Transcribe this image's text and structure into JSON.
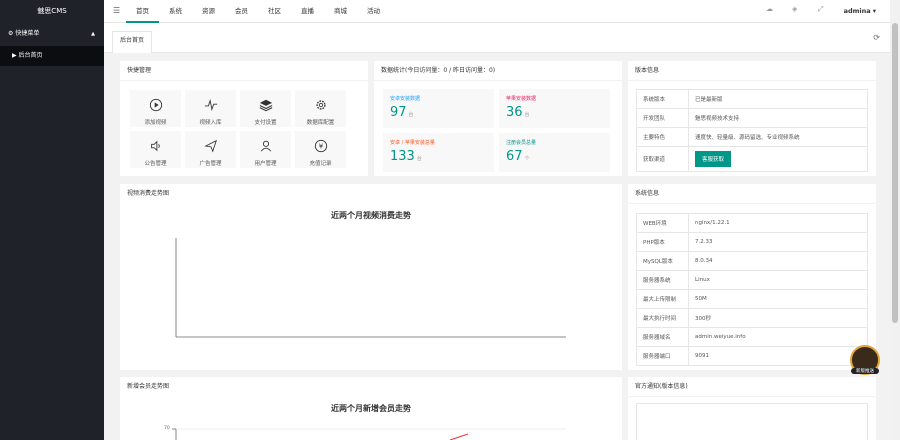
{
  "sidebar": {
    "logo": "魅思CMS",
    "menu_head": "快捷菜单",
    "menu_sub": "后台首页"
  },
  "topnav": {
    "items": [
      "首页",
      "系统",
      "资源",
      "会员",
      "社区",
      "直播",
      "商城",
      "活动"
    ],
    "user": "admina"
  },
  "tab": {
    "label": "后台首页"
  },
  "quick": {
    "title": "快捷管理",
    "items": [
      {
        "label": "添加视频",
        "icon": "play-icon"
      },
      {
        "label": "视频入库",
        "icon": "pulse-icon"
      },
      {
        "label": "支付设置",
        "icon": "layers-icon"
      },
      {
        "label": "数据库配置",
        "icon": "gear-icon"
      },
      {
        "label": "公告管理",
        "icon": "speaker-icon"
      },
      {
        "label": "广告管理",
        "icon": "send-icon"
      },
      {
        "label": "用户管理",
        "icon": "user-icon"
      },
      {
        "label": "充值记录",
        "icon": "yen-icon"
      }
    ]
  },
  "stats": {
    "title": "数据统计(今日访问量：0 / 昨日访问量：0)",
    "boxes": [
      {
        "label": "安卓安装数据",
        "value": "97",
        "unit": "台",
        "color": "#1e9fff"
      },
      {
        "label": "苹果安装数据",
        "value": "36",
        "unit": "台",
        "color": "#e91e63"
      },
      {
        "label": "安卓 / 苹果安装总量",
        "value": "133",
        "unit": "台",
        "color": "#ff5722"
      },
      {
        "label": "注册会员总量",
        "value": "67",
        "unit": "个",
        "color": "#009688"
      }
    ]
  },
  "version": {
    "title": "版本信息",
    "rows": [
      {
        "k": "系统版本",
        "v": "已是最新版"
      },
      {
        "k": "开发团队",
        "v": "魅思视频技术支持"
      },
      {
        "k": "主要特色",
        "v": "速度快、轻量级、源码留选、专业视频系统"
      },
      {
        "k": "获取渠道",
        "v": "客服获取"
      }
    ]
  },
  "sysinfo": {
    "title": "系统信息",
    "rows": [
      {
        "k": "WEB环境",
        "v": "nginx/1.22.1"
      },
      {
        "k": "PHP版本",
        "v": "7.2.33"
      },
      {
        "k": "MySQL版本",
        "v": "8.0.34"
      },
      {
        "k": "服务器系统",
        "v": "Linux"
      },
      {
        "k": "最大上传限制",
        "v": "50M"
      },
      {
        "k": "最大执行时间",
        "v": "300秒"
      },
      {
        "k": "服务器域名",
        "v": "admin.weiyue.info"
      },
      {
        "k": "服务器端口",
        "v": "9091"
      }
    ]
  },
  "consume_chart": {
    "panel_title": "视频消费走势图",
    "title": "近两个月视频消费走势"
  },
  "member_chart": {
    "panel_title": "新增会员走势图",
    "title": "近两个月新增会员走势",
    "ytick": "70"
  },
  "notice": {
    "title": "官方通知(版本信息)"
  },
  "float_badge": {
    "label": "新版推送"
  },
  "colors": {
    "accent": "#009688",
    "sidebar": "#20222a"
  }
}
